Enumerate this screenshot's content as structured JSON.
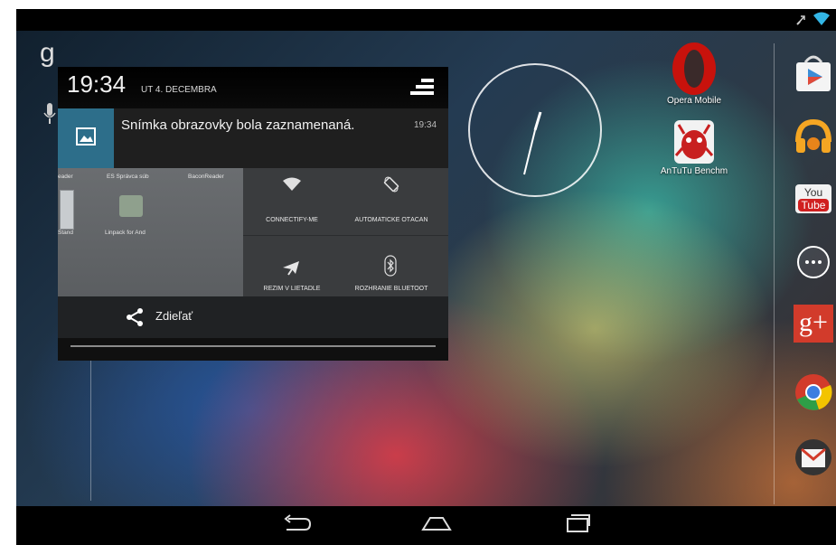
{
  "statusbar": {
    "icons": [
      "missed-call-icon",
      "wifi-icon"
    ]
  },
  "launcher": {
    "search_letter": "g",
    "apps": [
      {
        "label": "Opera Mobile",
        "icon": "opera-icon"
      },
      {
        "label": "AnTuTu Benchm",
        "icon": "antutu-icon"
      }
    ],
    "dock": [
      {
        "name": "play-store-icon"
      },
      {
        "name": "play-music-icon"
      },
      {
        "name": "youtube-icon",
        "text_top": "You",
        "text_bottom": "Tube"
      },
      {
        "name": "all-apps-icon"
      },
      {
        "name": "google-plus-icon",
        "text": "g+"
      },
      {
        "name": "chrome-icon"
      },
      {
        "name": "gmail-icon",
        "text": "M"
      }
    ]
  },
  "notification_panel": {
    "time": "19:34",
    "date": "UT 4. DECEMBRA",
    "notification": {
      "title": "Snímka obrazovky bola zaznamenaná.",
      "time": "19:34"
    },
    "preview": {
      "labels": [
        "eader",
        "ES Správca súb",
        "BaconReader"
      ],
      "app_labels": [
        "Stand",
        "Linpack for And"
      ],
      "quick_settings": [
        {
          "label": "CONNECTIFY-ME",
          "icon": "wifi-icon"
        },
        {
          "label": "AUTOMATICKÉ OTÁČAN",
          "icon": "auto-rotate-icon"
        },
        {
          "label": "REŽIM V LIETADLE",
          "icon": "airplane-icon"
        },
        {
          "label": "ROZHRANIE BLUETOOT",
          "icon": "bluetooth-icon"
        }
      ]
    },
    "action": {
      "label": "Zdieľať",
      "icon": "share-icon"
    }
  },
  "navbar": {
    "buttons": [
      "back-button",
      "home-button",
      "recents-button"
    ]
  },
  "colors": {
    "notification_accent": "#2d6e8a",
    "wifi": "#33b5e5"
  }
}
